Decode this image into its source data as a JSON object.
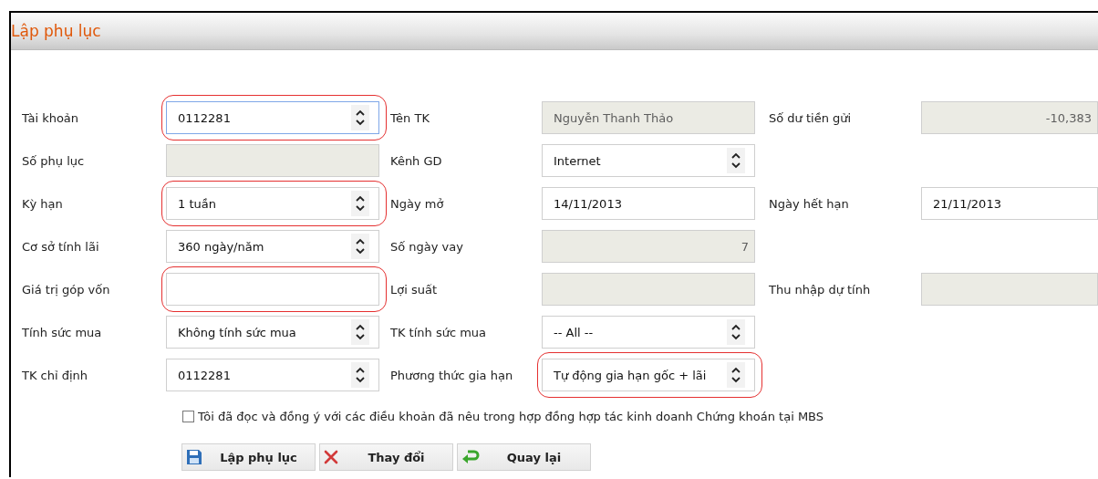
{
  "window": {
    "title": "Lập phụ lục"
  },
  "rows": [
    [
      {
        "label": "Tài khoản",
        "field": {
          "kind": "select",
          "value": "0112281",
          "highlighted": true,
          "focused": true
        }
      },
      {
        "label": "Tên TK",
        "field": {
          "kind": "readonly",
          "value": "Nguyễn Thanh Thảo"
        }
      },
      {
        "label": "Số dư tiền gửi",
        "field": {
          "kind": "number",
          "value": "-10,383"
        }
      }
    ],
    [
      {
        "label": "Số phụ lục",
        "field": {
          "kind": "readonly"
        }
      },
      {
        "label": "Kênh GD",
        "field": {
          "kind": "select",
          "value": "Internet"
        }
      }
    ],
    [
      {
        "label": "Kỳ hạn",
        "field": {
          "kind": "select",
          "value": "1 tuần",
          "highlighted": true
        }
      },
      {
        "label": "Ngày mở",
        "field": {
          "kind": "text",
          "value": "14/11/2013"
        }
      },
      {
        "label": "Ngày hết hạn",
        "field": {
          "kind": "text",
          "value": "21/11/2013"
        }
      }
    ],
    [
      {
        "label": "Cơ sở tính lãi",
        "field": {
          "kind": "select",
          "value": "360 ngày/năm"
        }
      },
      {
        "label": "Số ngày vay",
        "field": {
          "kind": "number",
          "value": "7"
        }
      }
    ],
    [
      {
        "label": "Giá trị góp vốn",
        "field": {
          "kind": "text",
          "highlighted": true
        }
      },
      {
        "label": "Lợi suất",
        "field": {
          "kind": "readonly"
        }
      },
      {
        "label": "Thu nhập dự tính",
        "field": {
          "kind": "readonly"
        }
      }
    ],
    [
      {
        "label": "Tính sức mua",
        "field": {
          "kind": "select",
          "value": "Không tính sức mua"
        }
      },
      {
        "label": "TK tính sức mua",
        "field": {
          "kind": "select",
          "value": "-- All --"
        }
      }
    ],
    [
      {
        "label": "TK chỉ định",
        "field": {
          "kind": "select",
          "value": "0112281"
        }
      },
      {
        "label": "Phương thức gia hạn",
        "field": {
          "kind": "select",
          "value": "Tự động gia hạn gốc + lãi",
          "highlighted": true
        }
      }
    ]
  ],
  "agreement": {
    "label": "Tôi đã đọc và đồng ý với các điều khoản đã nêu trong hợp đồng hợp tác kinh doanh Chứng khoán tại MBS",
    "checked": false
  },
  "buttons": [
    {
      "label": "Lập phụ lục",
      "kind": "save"
    },
    {
      "label": "Thay đổi",
      "kind": "cancel"
    },
    {
      "label": "Quay lại",
      "kind": "back"
    }
  ]
}
